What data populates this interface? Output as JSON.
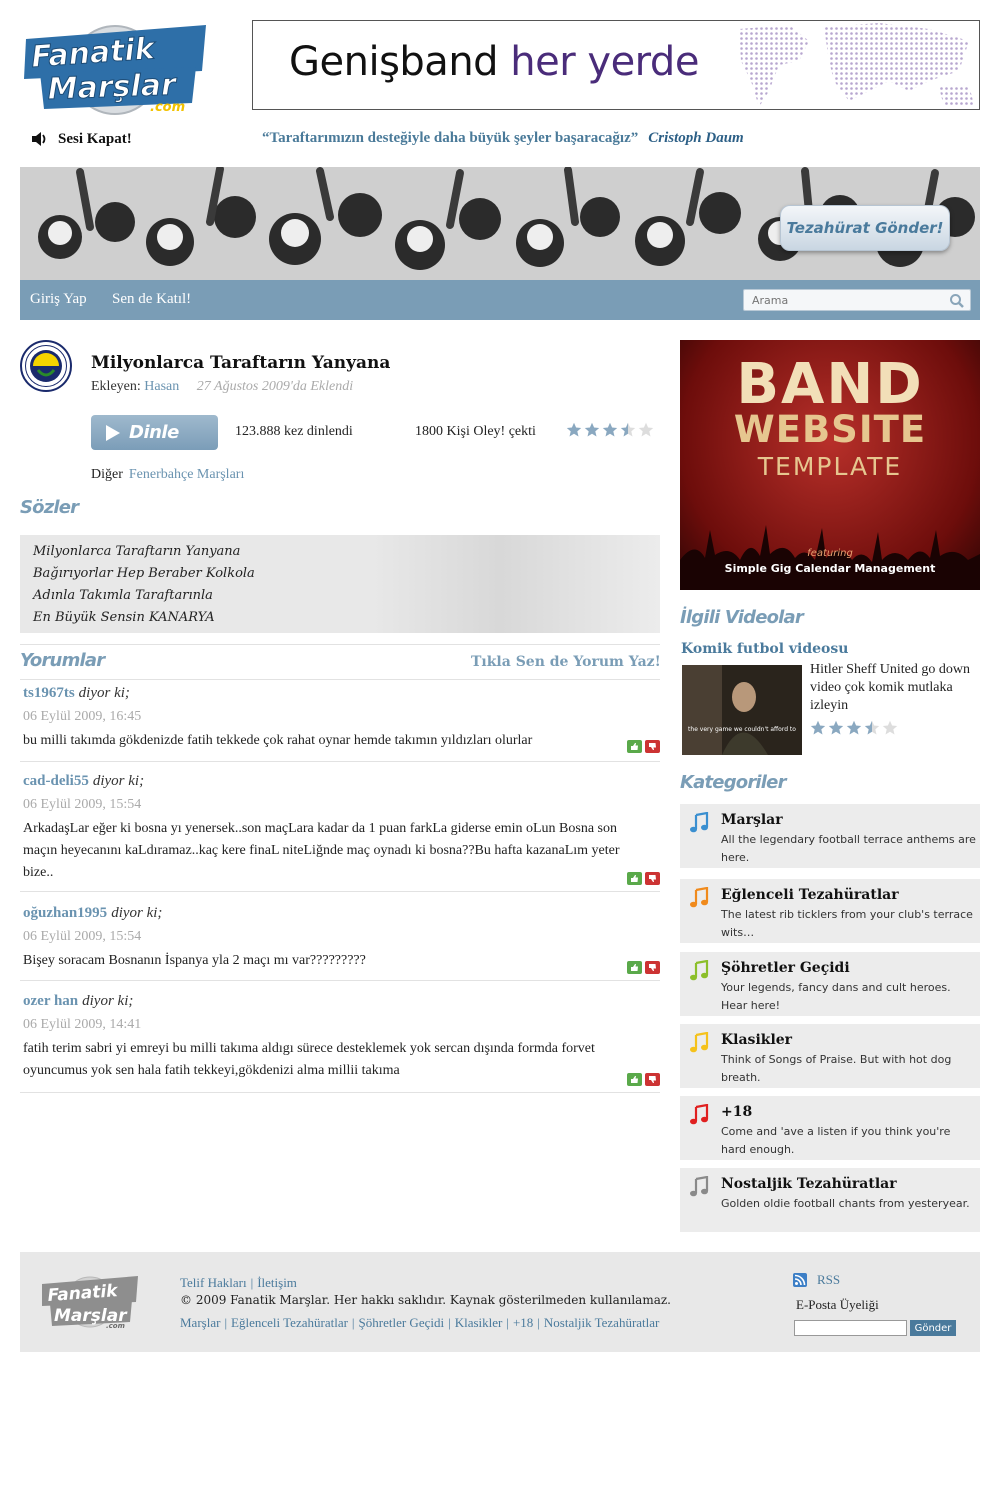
{
  "logo": {
    "line1": "Fanatik",
    "line2": "Marşlar",
    "suffix": ".com"
  },
  "banner_ad": {
    "text_a": "Genişband",
    "text_b": "her yerde"
  },
  "mute": {
    "label": "Sesi Kapat!",
    "icon": "speaker-icon"
  },
  "quote": {
    "text": "“Taraftarımızın desteğiyle daha büyük şeyler başaracağız”",
    "author": "Cristoph Daum"
  },
  "hero": {
    "button": "Tezahürat Gönder!"
  },
  "nav": {
    "login": "Giriş Yap",
    "join": "Sen de Katıl!",
    "search_placeholder": "Arama"
  },
  "song": {
    "title": "Milyonlarca Taraftarın Yanyana",
    "added_by_label": "Ekleyen:",
    "added_by_user": "Hasan",
    "added_date": "27 Ağustos 2009'da Eklendi",
    "listen_label": "Dinle",
    "listen_count": "123.888 kez dinlendi",
    "oley_count": "1800 Kişi Oley! çekti",
    "rating": 3.5,
    "rating_max": 5,
    "other_label": "Diğer",
    "other_link": "Fenerbahçe Marşları"
  },
  "lyrics": {
    "heading": "Sözler",
    "lines": [
      "Milyonlarca Taraftarın Yanyana",
      "Bağırıyorlar Hep Beraber Kolkola",
      "Adınla Takımla Taraftarınla",
      "En Büyük Sensin KANARYA"
    ]
  },
  "comments": {
    "heading": "Yorumlar",
    "write_link": "Tıkla Sen de Yorum Yaz!",
    "says": "diyor ki;",
    "items": [
      {
        "author": "ts1967ts",
        "date": "06 Eylül 2009, 16:45",
        "text": "bu milli takımda gökdenizde fatih tekkede çok rahat oynar hemde takımın yıldızları olurlar"
      },
      {
        "author": "cad-deli55",
        "date": "06 Eylül 2009, 15:54",
        "text": "ArkadaşLar eğer ki bosna yı yenersek..son maçLara kadar da 1 puan farkLa giderse emin oLun Bosna son maçın heyecanını kaLdıramaz..kaç kere finaL niteLiğnde maç oynadı ki bosna??Bu hafta kazanaLım yeter bize.."
      },
      {
        "author": "oğuzhan1995",
        "date": "06 Eylül 2009, 15:54",
        "text": "Bişey soracam Bosnanın İspanya yla 2 maçı mı var?????????"
      },
      {
        "author": "ozer han",
        "date": "06 Eylül 2009, 14:41",
        "text": "fatih terim sabri yi emreyi bu milli takıma aldıgı sürece desteklemek yok sercan dışında formda forvet oyuncumus yok sen hala fatih tekkeyi,gökdenizi alma millii takıma"
      }
    ]
  },
  "band_ad": {
    "line1": "BAND",
    "line2": "WEBSITE",
    "line3": "TEMPLATE",
    "line4": "featuring",
    "line5": "Simple Gig Calendar Management"
  },
  "videos": {
    "heading": "İlgili Videolar",
    "title": "Komik futbol videosu",
    "description": "Hitler Sheff United go down video çok komik mutlaka izleyin",
    "thumb_caption": "the very game we couldn't afford to",
    "rating": 3.5,
    "rating_max": 5
  },
  "categories": {
    "heading": "Kategoriler",
    "items": [
      {
        "name": "Marşlar",
        "desc": "All the legendary football terrace anthems are here.",
        "color": "#3a8fd0"
      },
      {
        "name": "Eğlenceli Tezahüratlar",
        "desc": "The latest rib ticklers from your club's terrace wits…",
        "color": "#f08a1c"
      },
      {
        "name": "Şöhretler Geçidi",
        "desc": "Your legends, fancy dans and cult heroes. Hear here!",
        "color": "#8cbf2a"
      },
      {
        "name": "Klasikler",
        "desc": "Think of Songs of Praise. But with hot dog breath.",
        "color": "#f5c21b"
      },
      {
        "name": "+18",
        "desc": "Come and 'ave a listen if you think you're hard enough.",
        "color": "#e02020"
      },
      {
        "name": "Nostaljik Tezahüratlar",
        "desc": "Golden oldie football chants from yesteryear.",
        "color": "#8a8a8a"
      }
    ]
  },
  "footer": {
    "links_top": [
      "Telif Hakları",
      "İletişim"
    ],
    "copyright": "© 2009 Fanatik Marşlar. Her hakkı saklıdır. Kaynak gösterilmeden kullanılamaz.",
    "links_bottom": [
      "Marşlar",
      "Eğlenceli Tezahüratlar",
      "Şöhretler Geçidi",
      "Klasikler",
      "+18",
      "Nostaljik Tezahüratlar"
    ],
    "rss": "RSS",
    "email_label": "E-Posta Üyeliği",
    "send": "Gönder"
  }
}
